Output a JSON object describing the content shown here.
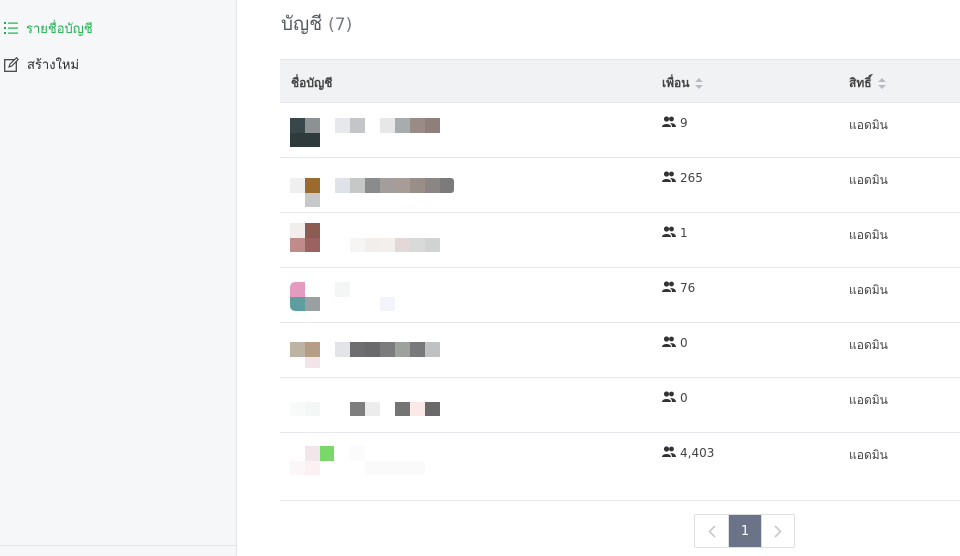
{
  "sidebar": {
    "items": [
      {
        "label": "รายชื่อบัญชี",
        "icon": "list-icon",
        "active": true
      },
      {
        "label": "สร้างใหม่",
        "icon": "edit-icon",
        "active": false
      }
    ]
  },
  "page": {
    "title": "บัญชี",
    "count": "(7)"
  },
  "table": {
    "headers": {
      "name": "ชื่อบัญชี",
      "friends": "เพื่อน",
      "role": "สิทธิ์"
    },
    "rows": [
      {
        "friends": "9",
        "role": "แอดมิน"
      },
      {
        "friends": "265",
        "role": "แอดมิน"
      },
      {
        "friends": "1",
        "role": "แอดมิน"
      },
      {
        "friends": "76",
        "role": "แอดมิน"
      },
      {
        "friends": "0",
        "role": "แอดมิน"
      },
      {
        "friends": "0",
        "role": "แอดมิน"
      },
      {
        "friends": "4,403",
        "role": "แอดมิน"
      }
    ]
  },
  "pagination": {
    "prev": "‹",
    "current": "1",
    "next": "›"
  },
  "colors": {
    "accent": "#1fb14f",
    "pager_active": "#6b7389"
  }
}
